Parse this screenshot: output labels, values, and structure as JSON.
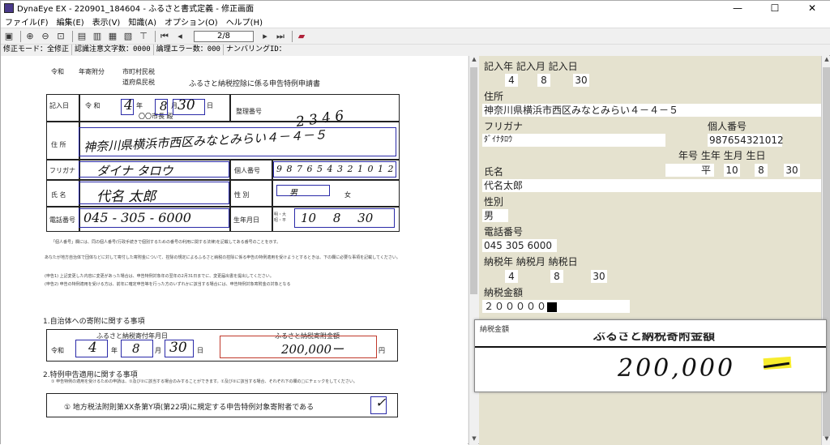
{
  "window": {
    "title": "DynaEye EX - 220901_184604 - ふるさと書式定義 - 修正画面",
    "min": "—",
    "max": "☐",
    "close": "✕"
  },
  "menu": [
    "ファイル(F)",
    "編集(E)",
    "表示(V)",
    "知識(A)",
    "オプション(O)",
    "ヘルプ(H)"
  ],
  "toolbar": {
    "page": "2/8"
  },
  "status": [
    "修正モード：全修正",
    "認識注意文字数：0000",
    "論理エラー数：000",
    "ナンバリングID："
  ],
  "doc": {
    "reiwa": "令和",
    "nenbun": "年寄附分",
    "shichoson": "市町村民税",
    "dofuken": "道府県民税",
    "heading": "ふるさと納税控除に係る申告特例申請書",
    "kinyubi": "記入日",
    "reiwa2": "令 和",
    "nen": "年",
    "gatsu": "月",
    "nichi": "日",
    "shicho": "〇〇市長 殿",
    "seiri": "整理番号",
    "jusho": "住 所",
    "furigana": "フリガナ",
    "kojin": "個人番号",
    "shimei": "氏 名",
    "seibetsu": "性 別",
    "denwa": "電話番号",
    "seinen": "生年月日",
    "onna": "女",
    "otoko": "男",
    "hw_date_y": "4",
    "hw_date_m": "8",
    "hw_date_d": "30",
    "hw_seiri": "2 3 4 6",
    "hw_addr": "神奈川県横浜市西区みなとみらい４－４－５",
    "hw_kana": "ダイナ タロウ",
    "hw_kojin": "9 8 7 6 5 4 3 2 1 0 1 2",
    "hw_name": "代名 太郎",
    "hw_tel": "045 - 305 - 6000",
    "hw_birth": "10 8 30",
    "birth_era": "明・大 昭・平",
    "note1": "「個人番号」欄には、同の個人番号(行政手続きで個別するための番号の利用に関する法律)を記載してある番号のことを示す。",
    "note2": "あなたが地方自治体で団体などに対して寄付した寄附金について、控除の規定によるふるさと納税の控除に係る申告の特例適用を受けようとするときは、下の欄に必要な事項を記載してください。",
    "note3": "(申告1)  上記変更した内容に変更があった場合は、申告特例対象年の翌年の2月31日までに、変更届出書を提出してください。",
    "note4": "(申告2)  申告の特例適用を受ける方は、前年に確定申告等を行った方のいずれかに該当する場合には、申告特例対象寄附金の対象となる",
    "sec1": "1.自治体への寄附に関する事項",
    "sec1_date": "ふるさと納税寄付年月日",
    "sec1_amt": "ふるさと納税寄附金額",
    "hw_amt": "200,000ー",
    "en": "円",
    "sec2": "2.特例申告適用に関する事項",
    "sec2_note": "① 申告特例の適用を受けるための申請は、①及び②に該当する場合のみすることができます。①及び②に該当する場合、それぞれ下の欄の□にチェックをしてください。",
    "chk1": "① 地方税法附則第XX条第Y項(第22項)に規定する申告特例対象寄附者である"
  },
  "form": {
    "lbl_kinyu": "記入年 記入月 記入日",
    "kinyu_y": "4",
    "kinyu_m": "8",
    "kinyu_d": "30",
    "lbl_addr": "住所",
    "addr": "神奈川県横浜市西区みなとみらい４－４－５",
    "lbl_kana": "フリガナ",
    "lbl_kojin": "個人番号",
    "kana": "ﾀﾞｲﾅﾀﾛｳ",
    "kojin": "987654321012",
    "lbl_birthhdr": "年号  生年  生月  生日",
    "birth_era": "平",
    "birth_y": "10",
    "birth_m": "8",
    "birth_d": "30",
    "lbl_name": "氏名",
    "name": "代名太郎",
    "lbl_sex": "性別",
    "sex": "男",
    "lbl_tel": "電話番号",
    "tel": "045 305 6000",
    "lbl_nozei": "納税年  納税月  納税日",
    "nozei_y": "4",
    "nozei_m": "8",
    "nozei_d": "30",
    "lbl_amount": "納税金額",
    "amount": "２０００００"
  },
  "zoom": {
    "caption": "納税金額",
    "heading": "ぶるさと納税寄附金額",
    "value": "200,000"
  },
  "colors": {
    "form_bg": "#e5e2cf",
    "blue_box": "#2a2aa8",
    "red_box": "#c0392b",
    "highlight": "#f7ec2e"
  }
}
